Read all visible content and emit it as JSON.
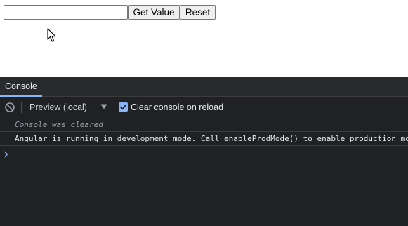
{
  "form": {
    "input_value": "",
    "get_value_label": "Get Value",
    "reset_label": "Reset"
  },
  "devtools": {
    "tab_label": "Console",
    "context_label": "Preview (local)",
    "clear_on_reload_label": "Clear console on reload",
    "clear_on_reload_checked": true,
    "messages": [
      {
        "type": "info",
        "text": "Console was cleared"
      },
      {
        "type": "log",
        "text": "Angular is running in development mode. Call enableProdMode() to enable production mode."
      }
    ]
  },
  "colors": {
    "console_bg": "#202124",
    "accent": "#8ab4f8"
  }
}
